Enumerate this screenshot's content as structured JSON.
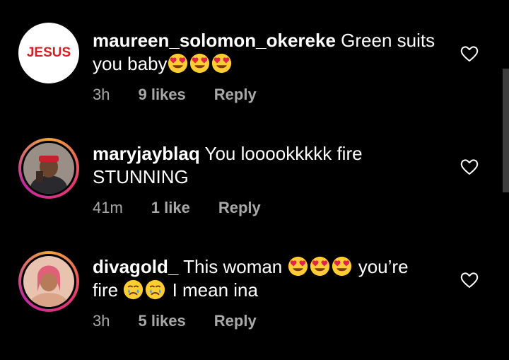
{
  "comments": [
    {
      "username": "maureen_solomon_okereke",
      "text_before": " Green suits you baby",
      "emoji_after": [
        "heart-eyes",
        "heart-eyes",
        "heart-eyes"
      ],
      "avatar_text": "JESUS",
      "time": "3h",
      "likes": "9 likes",
      "reply": "Reply"
    },
    {
      "username": "maryjayblaq",
      "text_before": " You looookkkkk fire STUNNING",
      "time": "41m",
      "likes": "1 like",
      "reply": "Reply"
    },
    {
      "username": "divagold_",
      "text_before": " This woman ",
      "text_mid": " you’re fire ",
      "text_after": " I mean ina",
      "time": "3h",
      "likes": "5 likes",
      "reply": "Reply"
    }
  ],
  "colors": {
    "background": "#000000",
    "text": "#ffffff",
    "meta": "#a8a8a8",
    "jesus_red": "#d52027"
  }
}
